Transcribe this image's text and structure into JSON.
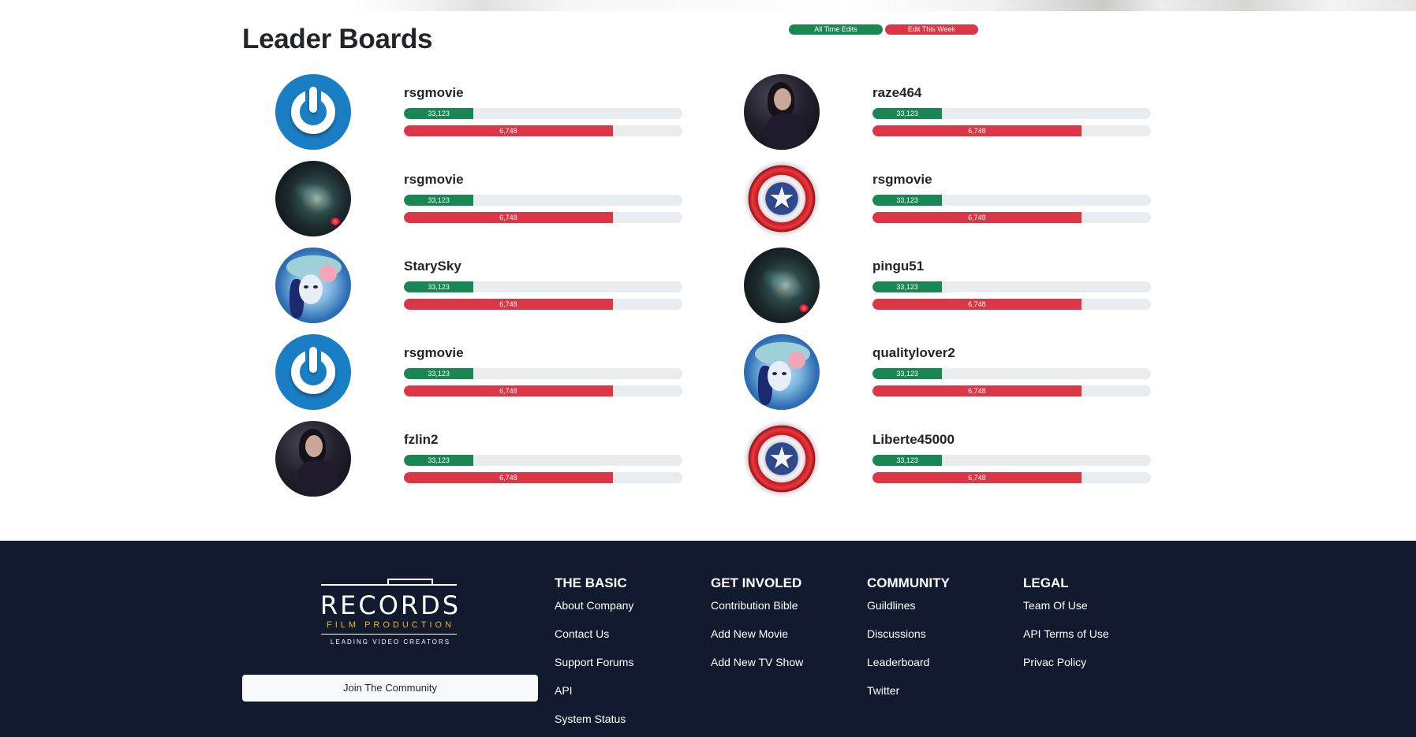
{
  "page": {
    "title": "Leader Boards"
  },
  "filters": {
    "all_time": "All Time Edits",
    "this_week": "Edit This Week"
  },
  "leaderboard": {
    "max_value": 100,
    "entries": [
      {
        "username": "rsgmovie",
        "avatar": "power-icon",
        "all_time": "33,123",
        "all_time_pct": 25,
        "week": "6,748",
        "week_pct": 75
      },
      {
        "username": "raze464",
        "avatar": "woman-photo",
        "all_time": "33,123",
        "all_time_pct": 25,
        "week": "6,748",
        "week_pct": 75
      },
      {
        "username": "rsgmovie",
        "avatar": "space-photo",
        "all_time": "33,123",
        "all_time_pct": 25,
        "week": "6,748",
        "week_pct": 75
      },
      {
        "username": "rsgmovie",
        "avatar": "shield-icon",
        "all_time": "33,123",
        "all_time_pct": 25,
        "week": "6,748",
        "week_pct": 75
      },
      {
        "username": "StarySky",
        "avatar": "art-portrait",
        "all_time": "33,123",
        "all_time_pct": 25,
        "week": "6,748",
        "week_pct": 75
      },
      {
        "username": "pingu51",
        "avatar": "space-photo",
        "all_time": "33,123",
        "all_time_pct": 25,
        "week": "6,748",
        "week_pct": 75
      },
      {
        "username": "rsgmovie",
        "avatar": "power-icon",
        "all_time": "33,123",
        "all_time_pct": 25,
        "week": "6,748",
        "week_pct": 75
      },
      {
        "username": "qualitylover2",
        "avatar": "art-portrait",
        "all_time": "33,123",
        "all_time_pct": 25,
        "week": "6,748",
        "week_pct": 75
      },
      {
        "username": "fzlin2",
        "avatar": "woman-photo",
        "all_time": "33,123",
        "all_time_pct": 25,
        "week": "6,748",
        "week_pct": 75
      },
      {
        "username": "Liberte45000",
        "avatar": "shield-icon",
        "all_time": "33,123",
        "all_time_pct": 25,
        "week": "6,748",
        "week_pct": 75
      }
    ]
  },
  "footer": {
    "logo": {
      "word": "RECORDS",
      "sub": "FILM PRODUCTION",
      "tag": "LEADING VIDEO CREATORS"
    },
    "join_label": "Join The Community",
    "columns": [
      {
        "heading": "THE BASIC",
        "links": [
          "About Company",
          "Contact Us",
          "Support Forums",
          "API",
          "System Status"
        ]
      },
      {
        "heading": "GET INVOLED",
        "links": [
          "Contribution Bible",
          "Add New Movie",
          "Add New TV Show"
        ]
      },
      {
        "heading": "COMMUNITY",
        "links": [
          "Guildlines",
          "Discussions",
          "Leaderboard",
          "Twitter"
        ]
      },
      {
        "heading": "LEGAL",
        "links": [
          "Team Of Use",
          "API Terms of Use",
          "Privac Policy"
        ]
      }
    ]
  },
  "colors": {
    "green": "#198754",
    "red": "#dc3545",
    "footer_bg": "#111a2e",
    "logo_accent": "#f0b323"
  }
}
